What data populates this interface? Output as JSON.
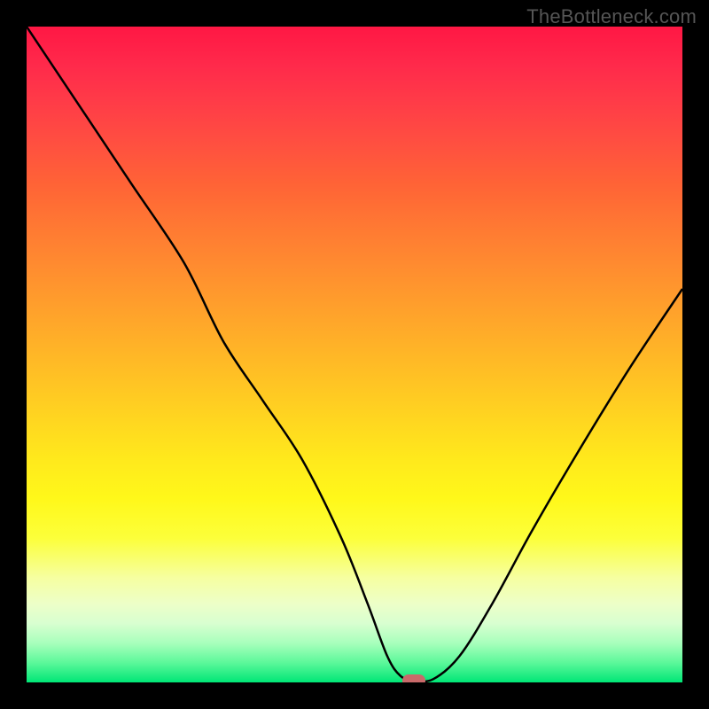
{
  "watermark": "TheBottleneck.com",
  "chart_data": {
    "type": "line",
    "title": "",
    "xlabel": "",
    "ylabel": "",
    "xlim": [
      0,
      100
    ],
    "ylim": [
      0,
      100
    ],
    "series": [
      {
        "name": "bottleneck-curve",
        "x": [
          0,
          8,
          16,
          24,
          30,
          36,
          42,
          48,
          52,
          55,
          57,
          59,
          62,
          66,
          71,
          77,
          84,
          92,
          100
        ],
        "y": [
          100,
          88,
          76,
          64,
          52,
          43,
          34,
          22,
          12,
          4,
          1,
          0.3,
          0.5,
          4,
          12,
          23,
          35,
          48,
          60
        ]
      }
    ],
    "marker": {
      "x": 59,
      "y": 0.3
    },
    "background_gradient": {
      "top_color": "#ff1744",
      "mid_color": "#ffd620",
      "bottom_color": "#00e676"
    }
  }
}
